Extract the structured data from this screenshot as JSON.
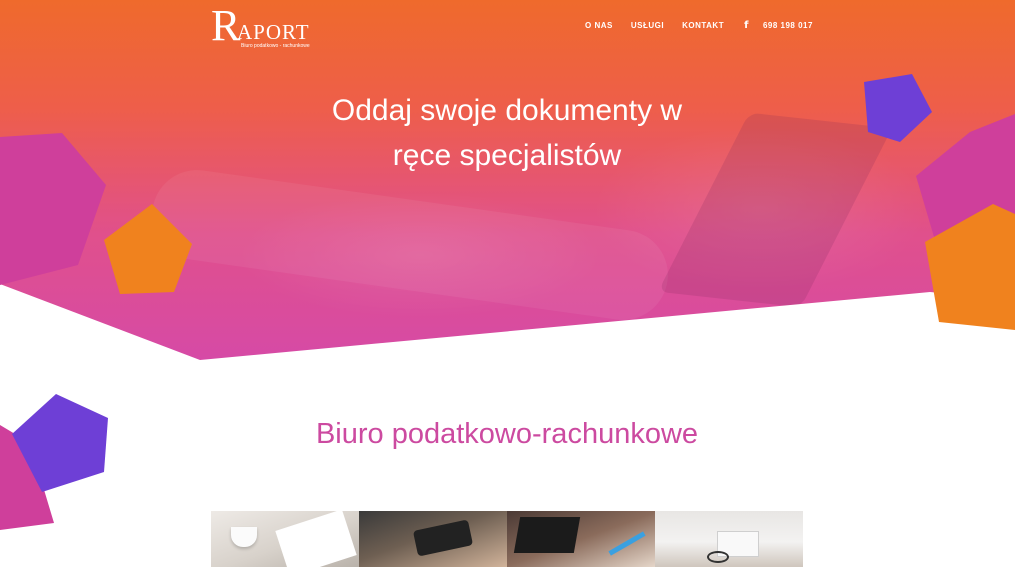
{
  "brand": {
    "logo_initial": "R",
    "logo_rest": "APORT",
    "tagline": "Biuro podatkowo - rachunkowe"
  },
  "nav": {
    "items": [
      {
        "label": "O NAS"
      },
      {
        "label": "USŁUGI"
      },
      {
        "label": "KONTAKT"
      }
    ],
    "facebook_icon": "f",
    "phone": "698 198 017"
  },
  "hero": {
    "headline_line1": "Oddaj swoje dokumenty w",
    "headline_line2": "ręce specjalistów"
  },
  "section": {
    "title": "Biuro podatkowo-rachunkowe"
  },
  "colors": {
    "orange": "#ef6a2c",
    "magenta": "#d64aa6",
    "purple": "#6e3fd6",
    "pink_shape": "#cf3f9b",
    "orange_shape": "#f0821e",
    "title": "#cc4aa0"
  }
}
